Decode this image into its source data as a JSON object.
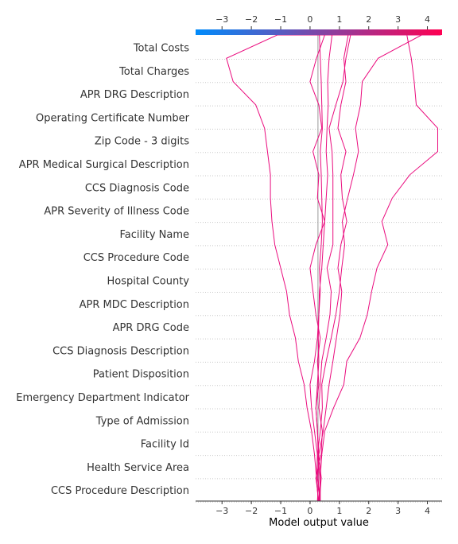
{
  "chart_data": {
    "type": "decision_plot",
    "xlabel": "Model output value",
    "xlim": [
      -3.9,
      4.5
    ],
    "ticks": [
      -3,
      -2,
      -1,
      0,
      1,
      2,
      3,
      4
    ],
    "base_value": 0.27,
    "features": [
      "Total Costs",
      "Total Charges",
      "APR DRG Description",
      "Operating Certificate Number",
      "Zip Code - 3 digits",
      "APR Medical Surgical Description",
      "CCS Diagnosis Code",
      "APR Severity of Illness Code",
      "Facility Name",
      "CCS Procedure Code",
      "Hospital County",
      "APR MDC Description",
      "APR DRG Code",
      "CCS Diagnosis Description",
      "Patient Disposition",
      "Emergency Department Indicator",
      "Type of Admission",
      "Facility Id",
      "Health Service Area",
      "CCS Procedure Description"
    ],
    "colormap": {
      "low": "#008bfb",
      "high": "#ff0052"
    },
    "line_color": "#ea0c7e",
    "series": [
      {
        "values": [
          0.25,
          0.3,
          0.28,
          0.25,
          0.2,
          0.25,
          0.3,
          0.28,
          0.3,
          0.35,
          0.32,
          0.38,
          0.42,
          0.4,
          0.38,
          0.35,
          0.42,
          0.4,
          0.38,
          0.35,
          0.32,
          2.65
        ]
      },
      {
        "values": [
          0.3,
          0.35,
          0.25,
          0.15,
          0.05,
          0.0,
          0.15,
          0.25,
          0.3,
          0.32,
          0.4,
          0.45,
          0.5,
          0.55,
          0.6,
          0.55,
          0.58,
          0.62,
          0.6,
          0.65,
          0.75,
          3.1
        ]
      },
      {
        "values": [
          0.3,
          0.2,
          0.38,
          0.42,
          0.3,
          0.35,
          0.4,
          0.55,
          0.68,
          0.72,
          0.58,
          0.78,
          0.78,
          0.78,
          0.78,
          0.75,
          0.65,
          0.88,
          1.12,
          1.22,
          1.38,
          3.3
        ]
      },
      {
        "values": [
          0.35,
          0.25,
          0.3,
          0.45,
          0.55,
          0.65,
          0.78,
          0.9,
          1.02,
          1.08,
          0.95,
          1.05,
          1.25,
          1.1,
          1.05,
          1.22,
          0.95,
          1.05,
          1.22,
          1.15,
          1.3,
          3.48
        ]
      },
      {
        "values": [
          0.28,
          0.22,
          0.25,
          0.35,
          0.42,
          0.4,
          0.55,
          0.72,
          0.88,
          1.0,
          1.08,
          1.18,
          1.1,
          1.28,
          1.48,
          1.65,
          1.55,
          1.72,
          1.78,
          2.32,
          3.8,
          2.95
        ]
      },
      {
        "values": [
          0.35,
          0.35,
          0.4,
          0.5,
          0.8,
          1.15,
          1.25,
          1.7,
          1.95,
          2.1,
          2.28,
          2.65,
          2.45,
          2.8,
          3.4,
          4.35,
          4.35,
          3.62,
          3.55,
          3.45,
          3.3,
          4.4
        ]
      },
      {
        "values": [
          0.28,
          0.22,
          0.15,
          0.05,
          -0.1,
          -0.2,
          -0.4,
          -0.5,
          -0.7,
          -0.8,
          -1.0,
          -1.2,
          -1.3,
          -1.35,
          -1.35,
          -1.45,
          -1.55,
          -1.85,
          -2.62,
          -2.85,
          -1.12,
          3.4
        ]
      },
      {
        "values": [
          0.32,
          0.38,
          0.3,
          0.25,
          0.2,
          0.3,
          0.25,
          0.35,
          0.2,
          0.1,
          0.0,
          0.2,
          0.5,
          0.25,
          0.3,
          0.1,
          0.4,
          0.3,
          0.0,
          0.22,
          0.5,
          4.45
        ]
      }
    ]
  }
}
